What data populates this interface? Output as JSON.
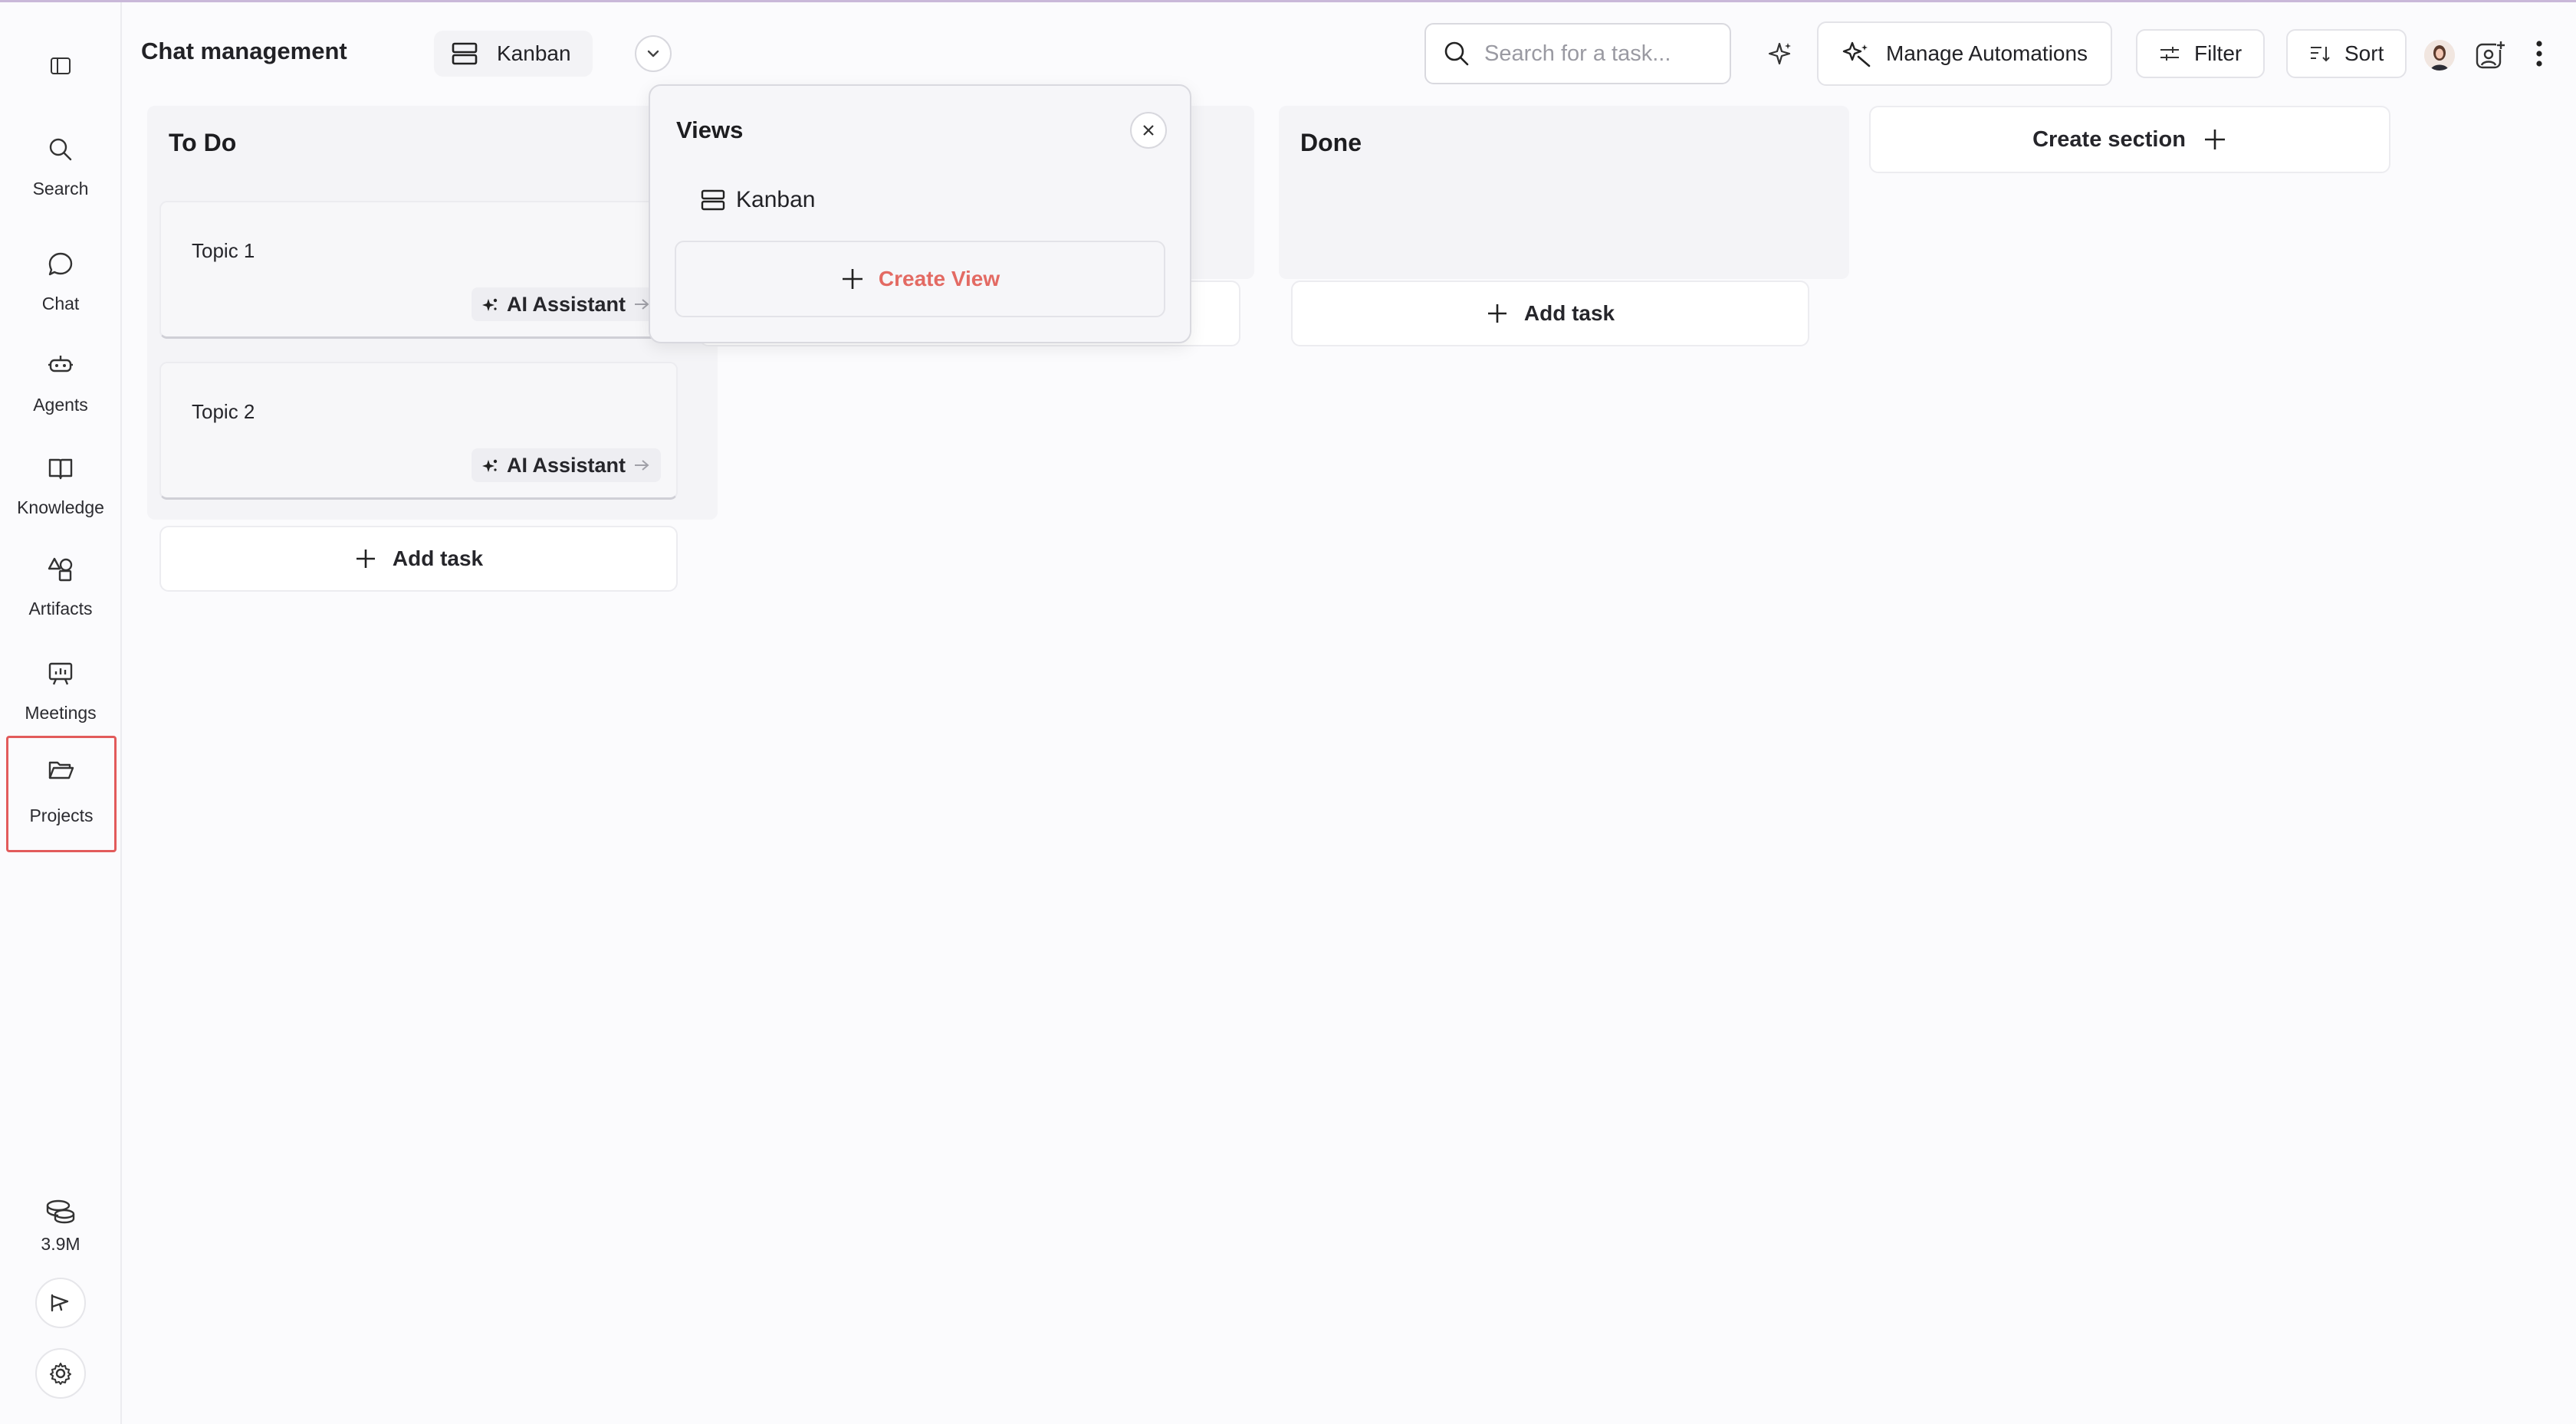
{
  "header": {
    "title": "Chat management",
    "view_label": "Kanban",
    "search_placeholder": "Search for a task...",
    "automations_label": "Manage Automations",
    "filter_label": "Filter",
    "sort_label": "Sort"
  },
  "sidebar": {
    "items": [
      {
        "label": "Search",
        "icon": "search-icon"
      },
      {
        "label": "Chat",
        "icon": "chat-bubble-icon"
      },
      {
        "label": "Agents",
        "icon": "agent-icon"
      },
      {
        "label": "Knowledge",
        "icon": "book-icon"
      },
      {
        "label": "Artifacts",
        "icon": "shapes-icon"
      },
      {
        "label": "Meetings",
        "icon": "presentation-icon"
      },
      {
        "label": "Projects",
        "icon": "folder-open-icon",
        "selected": true
      }
    ],
    "credits_label": "3.9M"
  },
  "board": {
    "columns": [
      {
        "title": "To Do",
        "tasks": [
          {
            "name": "Topic 1",
            "action": "AI Assistant"
          },
          {
            "name": "Topic 2",
            "action": "AI Assistant"
          }
        ],
        "add_label": "Add task"
      },
      {
        "title": "",
        "tasks": [],
        "add_label": ""
      },
      {
        "title": "Done",
        "tasks": [],
        "add_label": "Add task"
      }
    ],
    "create_section_label": "Create section"
  },
  "views_popover": {
    "title": "Views",
    "items": [
      {
        "label": "Kanban"
      }
    ],
    "create_label": "Create View"
  },
  "colors": {
    "accent": "#e36a63",
    "selected_border": "#e25b5b",
    "column_bg": "#f4f4f7"
  }
}
